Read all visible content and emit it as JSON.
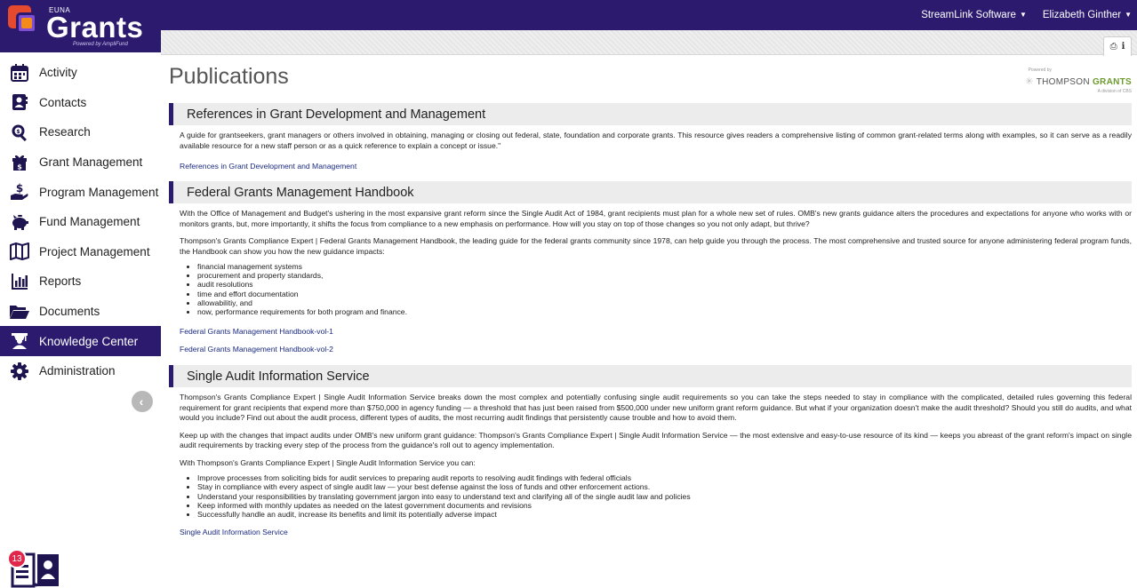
{
  "brand": {
    "top": "EUNA",
    "name": "Grants",
    "powered": "Powered by AmpliFund"
  },
  "sidebar": {
    "items": [
      {
        "label": "Activity",
        "icon": "calendar-icon",
        "active": false
      },
      {
        "label": "Contacts",
        "icon": "contacts-icon",
        "active": false
      },
      {
        "label": "Research",
        "icon": "search-icon",
        "active": false
      },
      {
        "label": "Grant Management",
        "icon": "gift-dollar-icon",
        "active": false
      },
      {
        "label": "Program Management",
        "icon": "hand-dollar-icon",
        "active": false
      },
      {
        "label": "Fund Management",
        "icon": "piggy-bank-icon",
        "active": false
      },
      {
        "label": "Project Management",
        "icon": "map-icon",
        "active": false
      },
      {
        "label": "Reports",
        "icon": "bar-chart-icon",
        "active": false
      },
      {
        "label": "Documents",
        "icon": "folder-open-icon",
        "active": false
      },
      {
        "label": "Knowledge Center",
        "icon": "graduate-icon",
        "active": true
      },
      {
        "label": "Administration",
        "icon": "gear-icon",
        "active": false
      }
    ],
    "help_badge": "13"
  },
  "topbar": {
    "org": "StreamLink Software",
    "user": "Elizabeth Ginther"
  },
  "page": {
    "title": "Publications",
    "powered_small": "Powered by",
    "powered_logo_a": "THOMPSON",
    "powered_logo_b": "GRANTS",
    "powered_sub": "A division of CBS"
  },
  "sections": {
    "refs": {
      "heading": "References in Grant Development and Management",
      "p1": "A guide for grantseekers, grant managers or others involved in obtaining, managing or closing out federal, state, foundation and corporate grants. This resource gives readers a comprehensive listing of common grant-related terms along with examples, so it can serve as a readily available resource for a new staff person or as a quick reference to explain a concept or issue.\"",
      "link": "References in Grant Development and Management"
    },
    "handbook": {
      "heading": "Federal Grants Management Handbook",
      "p1": "With the Office of Management and Budget's ushering in the most expansive grant reform since the Single Audit Act of 1984, grant recipients must plan for a whole new set of rules. OMB's new grants guidance alters the procedures and expectations for anyone who works with or monitors grants, but, more importantly, it shifts the focus from compliance to a new emphasis on performance. How will you stay on top of those changes so you not only adapt, but thrive?",
      "p2": "Thompson's Grants Compliance Expert | Federal Grants Management Handbook, the leading guide for the federal grants community since 1978, can help guide you through the process. The most comprehensive and trusted source for anyone administering federal program funds, the Handbook can show you how the new guidance impacts:",
      "bullets": [
        "financial management systems",
        "procurement and property standards,",
        "audit resolutions",
        "time and effort documentation",
        "allowabilitiy, and",
        "now, performance requirements for both program and finance."
      ],
      "link1": "Federal Grants Management Handbook-vol-1",
      "link2": "Federal Grants Management Handbook-vol-2"
    },
    "audit": {
      "heading": "Single Audit Information Service",
      "p1": "Thompson's Grants Compliance Expert | Single Audit Information Service breaks down the most complex and potentially confusing single audit requirements so you can take the steps needed to stay in compliance with the complicated, detailed rules governing this federal requirement for grant recipients that expend more than $750,000 in agency funding — a threshold that has just been raised from $500,000 under new uniform grant reform guidance. But what if your organization doesn't make the audit threshold? Should you still do audits, and what would you include? Find out about the audit process, different types of audits, the most recurring audit findings that persistently cause trouble and how to avoid them.",
      "p2": "Keep up with the changes that impact audits under OMB's new uniform grant guidance: Thompson's Grants Compliance Expert | Single Audit Information Service — the most extensive and easy-to-use resource of its kind — keeps you abreast of the grant reform's impact on single audit requirements by tracking every step of the process from the guidance's roll out to agency implementation.",
      "p3": "With Thompson's Grants Compliance Expert | Single Audit Information Service you can:",
      "bullets": [
        "Improve processes from soliciting bids for audit services to preparing audit reports to resolving audit findings with federal officials",
        "Stay in compliance with every aspect of single audit law — your best defense against the loss of funds and other enforcement actions.",
        "Understand your responsibilities by translating government jargon into easy to understand text and clarifying all of the single audit law and policies",
        "Keep informed with monthly updates as needed on the latest government documents and revisions",
        "Successfully handle an audit, increase its benefits and limit its potentially adverse impact"
      ],
      "link": "Single Audit Information Service"
    }
  },
  "colors": {
    "brand_navy": "#2b1a6e",
    "link": "#1a2a80",
    "badge": "#e0264a"
  }
}
